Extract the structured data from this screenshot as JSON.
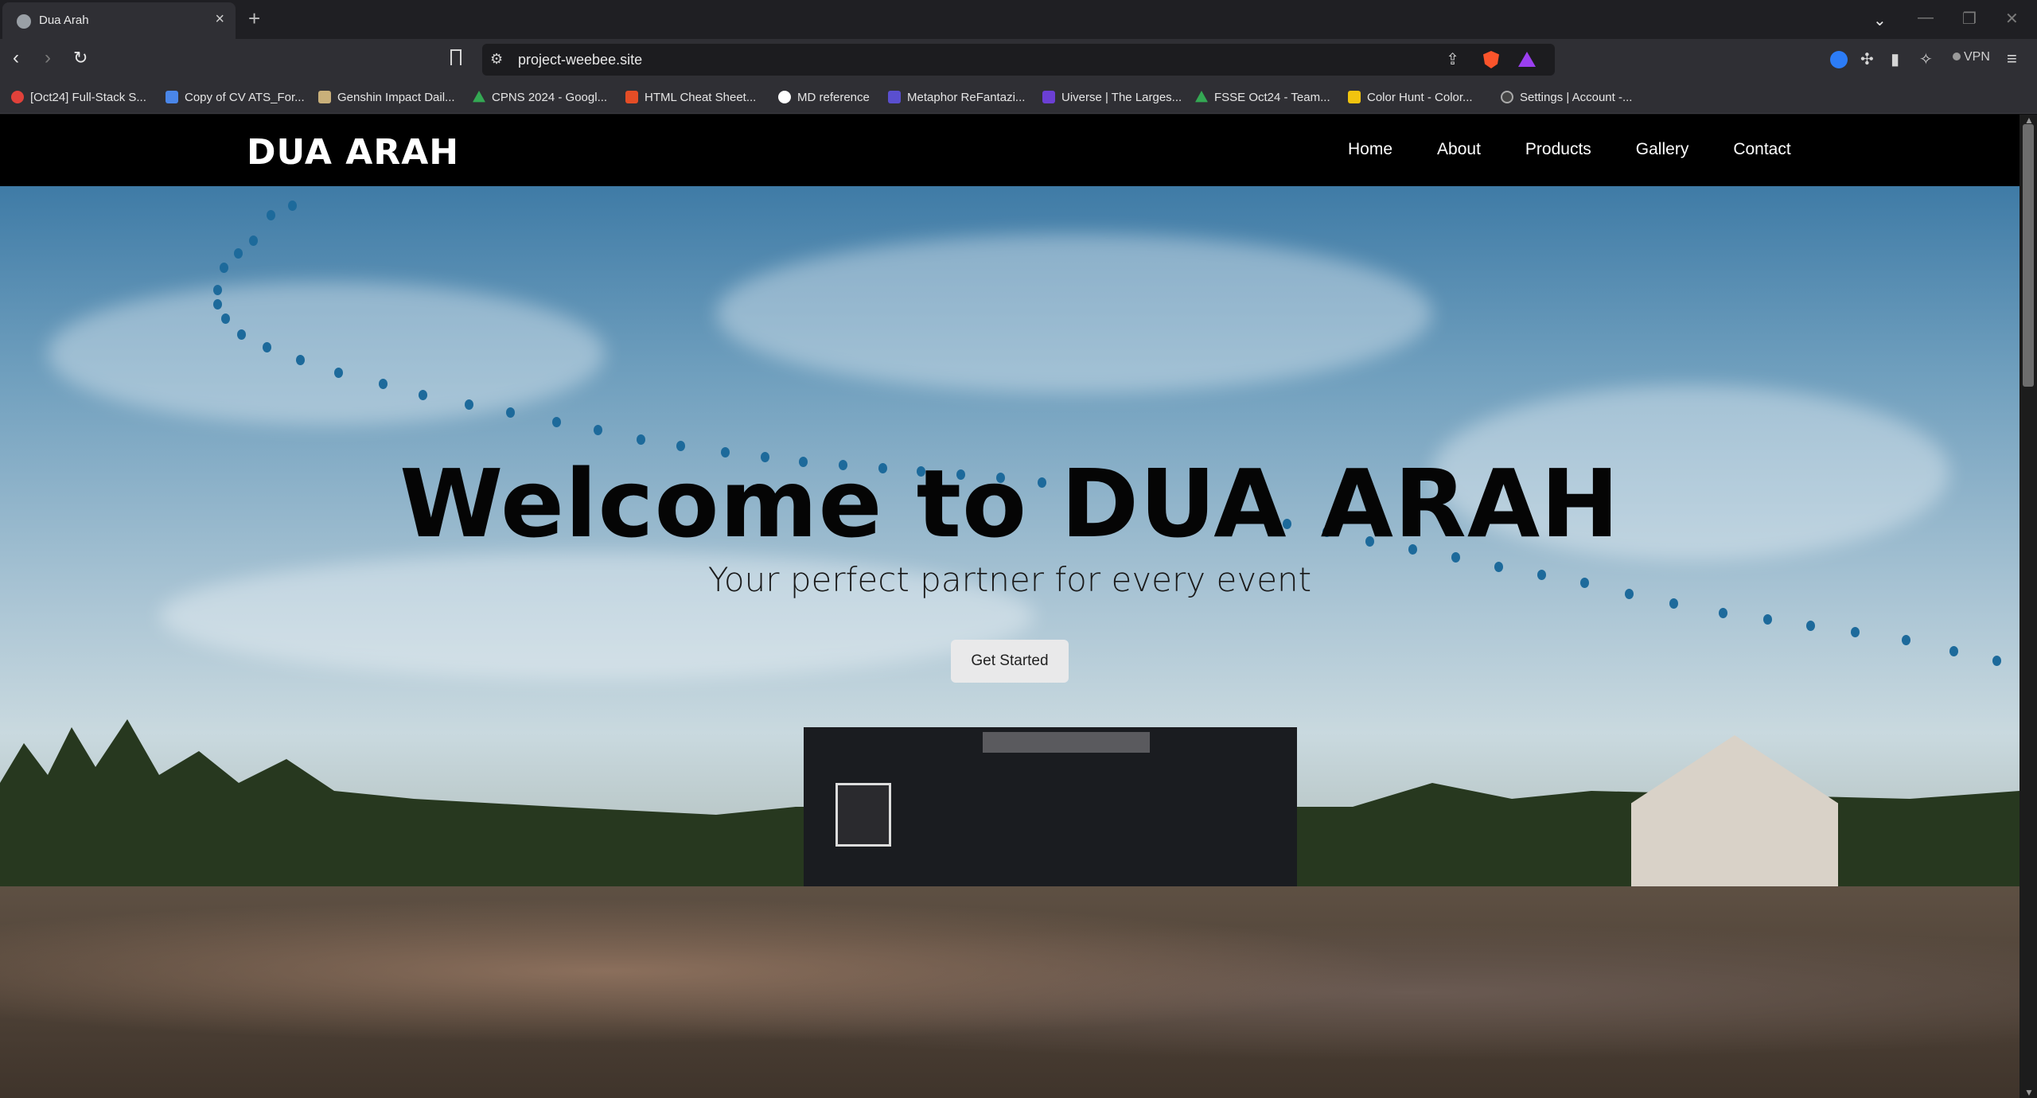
{
  "browser": {
    "tab_title": "Dua Arah",
    "new_tab": "+",
    "close": "×",
    "url": "project-weebee.site",
    "vpn_label": "VPN"
  },
  "bookmarks": [
    {
      "label": "[Oct24] Full-Stack S...",
      "color": "#e0413a"
    },
    {
      "label": "Copy of CV ATS_For...",
      "color": "#4a86e8"
    },
    {
      "label": "Genshin Impact Dail...",
      "color": "#c9b07a"
    },
    {
      "label": "CPNS 2024 - Googl...",
      "color": "#34a853"
    },
    {
      "label": "HTML Cheat Sheet...",
      "color": "#e44d26"
    },
    {
      "label": "MD reference",
      "color": "#ffffff"
    },
    {
      "label": "Metaphor ReFantazi...",
      "color": "#5a4fcf"
    },
    {
      "label": "Uiverse | The Larges...",
      "color": "#6b3fd4"
    },
    {
      "label": "FSSE Oct24 - Team...",
      "color": "#34a853"
    },
    {
      "label": "Color Hunt - Color...",
      "color": "#f1c40f"
    },
    {
      "label": "Settings | Account -...",
      "color": "#444444"
    }
  ],
  "site": {
    "logo": "DUA ARAH",
    "nav": [
      "Home",
      "About",
      "Products",
      "Gallery",
      "Contact"
    ],
    "hero_title": "Welcome to DUA ARAH",
    "hero_subtitle": "Your perfect partner for every event",
    "cta_label": "Get Started"
  },
  "colors": {
    "navbar_bg": "#000000",
    "cta_bg": "#e9e9ea",
    "balloon": "#1d6a9b"
  }
}
